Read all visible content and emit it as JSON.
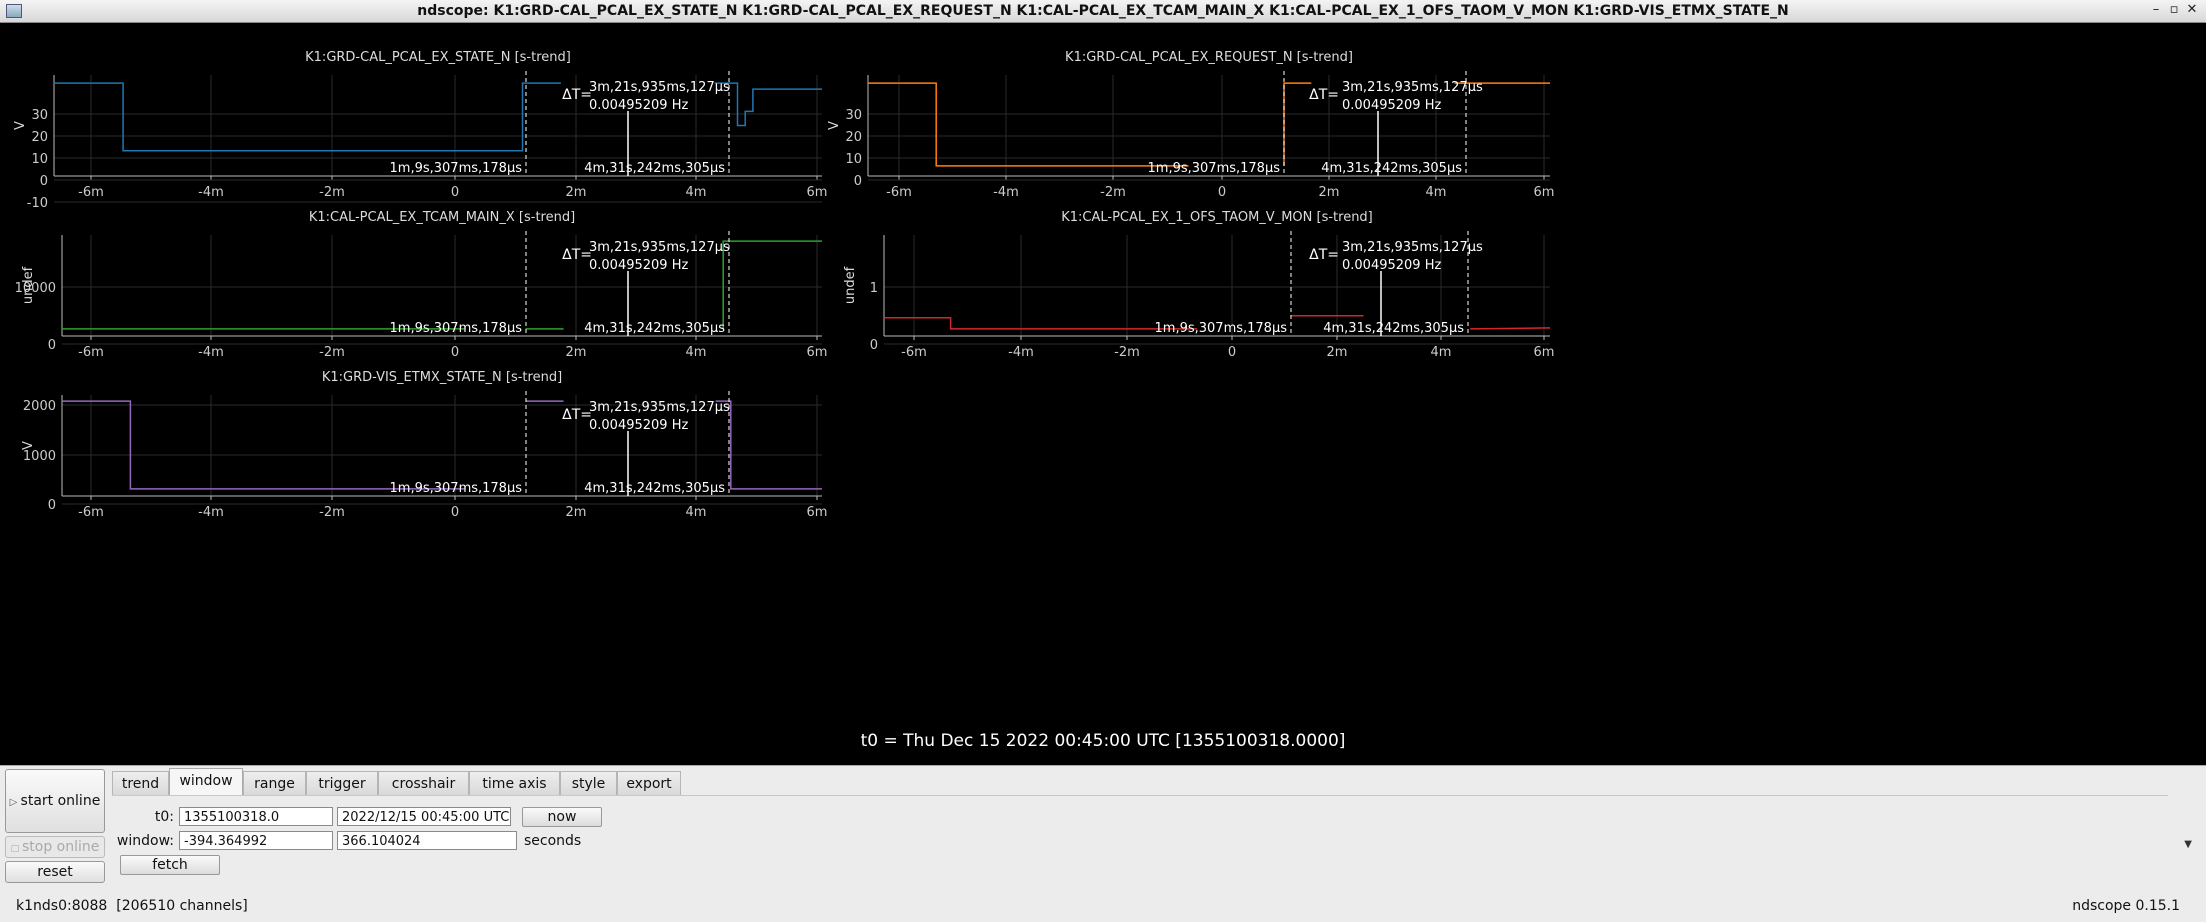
{
  "window": {
    "title": "ndscope: K1:GRD-CAL_PCAL_EX_STATE_N K1:GRD-CAL_PCAL_EX_REQUEST_N K1:CAL-PCAL_EX_TCAM_MAIN_X K1:CAL-PCAL_EX_1_OFS_TAOM_V_MON K1:GRD-VIS_ETMX_STATE_N",
    "minimize_glyph": "–",
    "close_glyph": "✕"
  },
  "cursor": {
    "delta_t": "ΔT=",
    "delta_value": "3m,21s,935ms,127µs",
    "freq": "0.00495209 Hz",
    "t1_label": "1m,9s,307ms,178µs",
    "t2_label": "4m,31s,242ms,305µs"
  },
  "x_ticks": [
    "-6m",
    "-4m",
    "-2m",
    "0",
    "2m",
    "4m",
    "6m"
  ],
  "plots": [
    {
      "title": "K1:GRD-CAL_PCAL_EX_STATE_N [s-trend]",
      "ylabel": "V",
      "yticks": [
        "30",
        "20",
        "10",
        "0",
        "-10"
      ],
      "color": "#1f77b4"
    },
    {
      "title": "K1:GRD-CAL_PCAL_EX_REQUEST_N [s-trend]",
      "ylabel": "V",
      "yticks": [
        "30",
        "20",
        "10",
        "0"
      ],
      "color": "#ff7f0e"
    },
    {
      "title": "K1:CAL-PCAL_EX_TCAM_MAIN_X [s-trend]",
      "ylabel": "undef",
      "yticks": [
        "10000",
        "0"
      ],
      "color": "#2ca02c"
    },
    {
      "title": "K1:CAL-PCAL_EX_1_OFS_TAOM_V_MON [s-trend]",
      "ylabel": "undef",
      "yticks": [
        "1",
        "0"
      ],
      "color": "#d62728"
    },
    {
      "title": "K1:GRD-VIS_ETMX_STATE_N [s-trend]",
      "ylabel": "V",
      "yticks": [
        "2000",
        "1000",
        "0"
      ],
      "color": "#9467bd"
    }
  ],
  "t0_label": "t0 = Thu Dec 15 2022 00:45:00 UTC [1355100318.0000]",
  "controls": {
    "start_online": "start online",
    "stop_online": "stop online",
    "reset": "reset",
    "tabs": [
      "trend",
      "window",
      "range",
      "trigger",
      "crosshair",
      "time axis",
      "style",
      "export"
    ],
    "active_tab": "window",
    "t0_label": "t0:",
    "t0_gps": "1355100318.0",
    "t0_utc": "2022/12/15 00:45:00 UTC",
    "now": "now",
    "window_label": "window:",
    "window_start": "-394.364992",
    "window_end": "366.104024",
    "seconds": "seconds",
    "fetch": "fetch"
  },
  "status": {
    "server": "k1nds0:8088",
    "channels": "[206510 channels]",
    "version": "ndscope 0.15.1"
  }
}
